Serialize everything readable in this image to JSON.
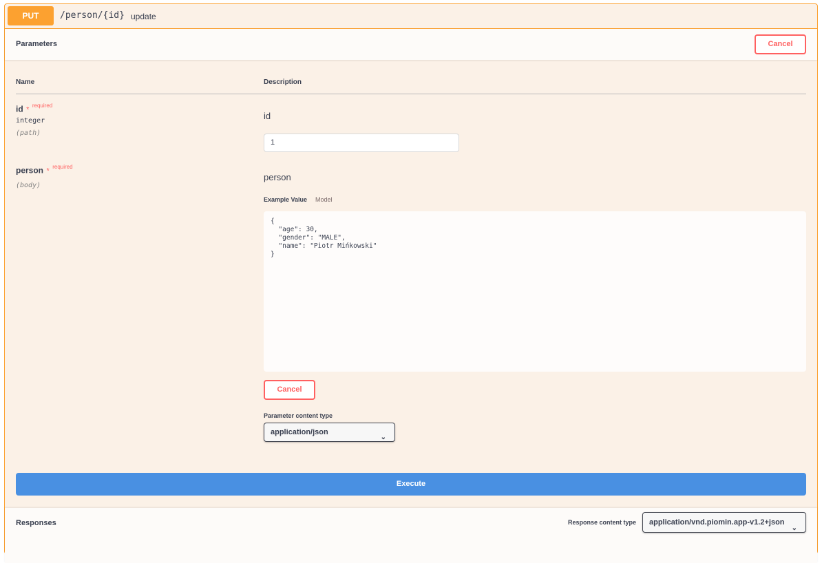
{
  "operation": {
    "method": "PUT",
    "path": "/person/{id}",
    "summary": "update"
  },
  "parameters": {
    "title": "Parameters",
    "cancel_label": "Cancel",
    "col_name": "Name",
    "col_description": "Description",
    "items": [
      {
        "name": "id",
        "star": "*",
        "required": "required",
        "type": "integer",
        "in": "(path)",
        "description": "id",
        "value": "1"
      },
      {
        "name": "person",
        "star": "*",
        "required": "required",
        "in": "(body)",
        "description": "person",
        "tabs": [
          "Example Value",
          "Model"
        ],
        "body": "{\n  \"age\": 30,\n  \"gender\": \"MALE\",\n  \"name\": \"Piotr Mińkowski\"\n}",
        "cancel_label": "Cancel",
        "content_type_label": "Parameter content type",
        "content_type": "application/json"
      }
    ]
  },
  "execute_label": "Execute",
  "responses": {
    "title": "Responses",
    "content_type_label": "Response content type",
    "content_type": "application/vnd.piomin.app-v1.2+json"
  },
  "colors": {
    "put": "#fca130",
    "cancel": "#ff6060",
    "execute": "#4990e2"
  }
}
